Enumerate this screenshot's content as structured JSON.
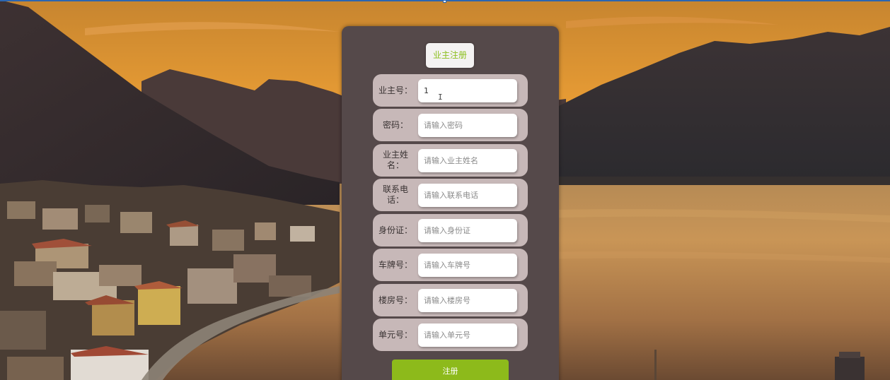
{
  "form": {
    "title": "业主注册",
    "fields": [
      {
        "label": "业主号：",
        "value": "1",
        "placeholder": ""
      },
      {
        "label": "密码：",
        "value": "",
        "placeholder": "请输入密码"
      },
      {
        "label": "业主姓名：",
        "value": "",
        "placeholder": "请输入业主姓名"
      },
      {
        "label": "联系电话：",
        "value": "",
        "placeholder": "请输入联系电话"
      },
      {
        "label": "身份证：",
        "value": "",
        "placeholder": "请输入身份证"
      },
      {
        "label": "车牌号：",
        "value": "",
        "placeholder": "请输入车牌号"
      },
      {
        "label": "楼房号：",
        "value": "",
        "placeholder": "请输入楼房号"
      },
      {
        "label": "单元号：",
        "value": "",
        "placeholder": "请输入单元号"
      }
    ],
    "submit_label": "注册"
  },
  "theme": {
    "panel_color": "#55494a",
    "field_row_color": "#c7b8b8",
    "accent_green": "#8dba1b"
  }
}
